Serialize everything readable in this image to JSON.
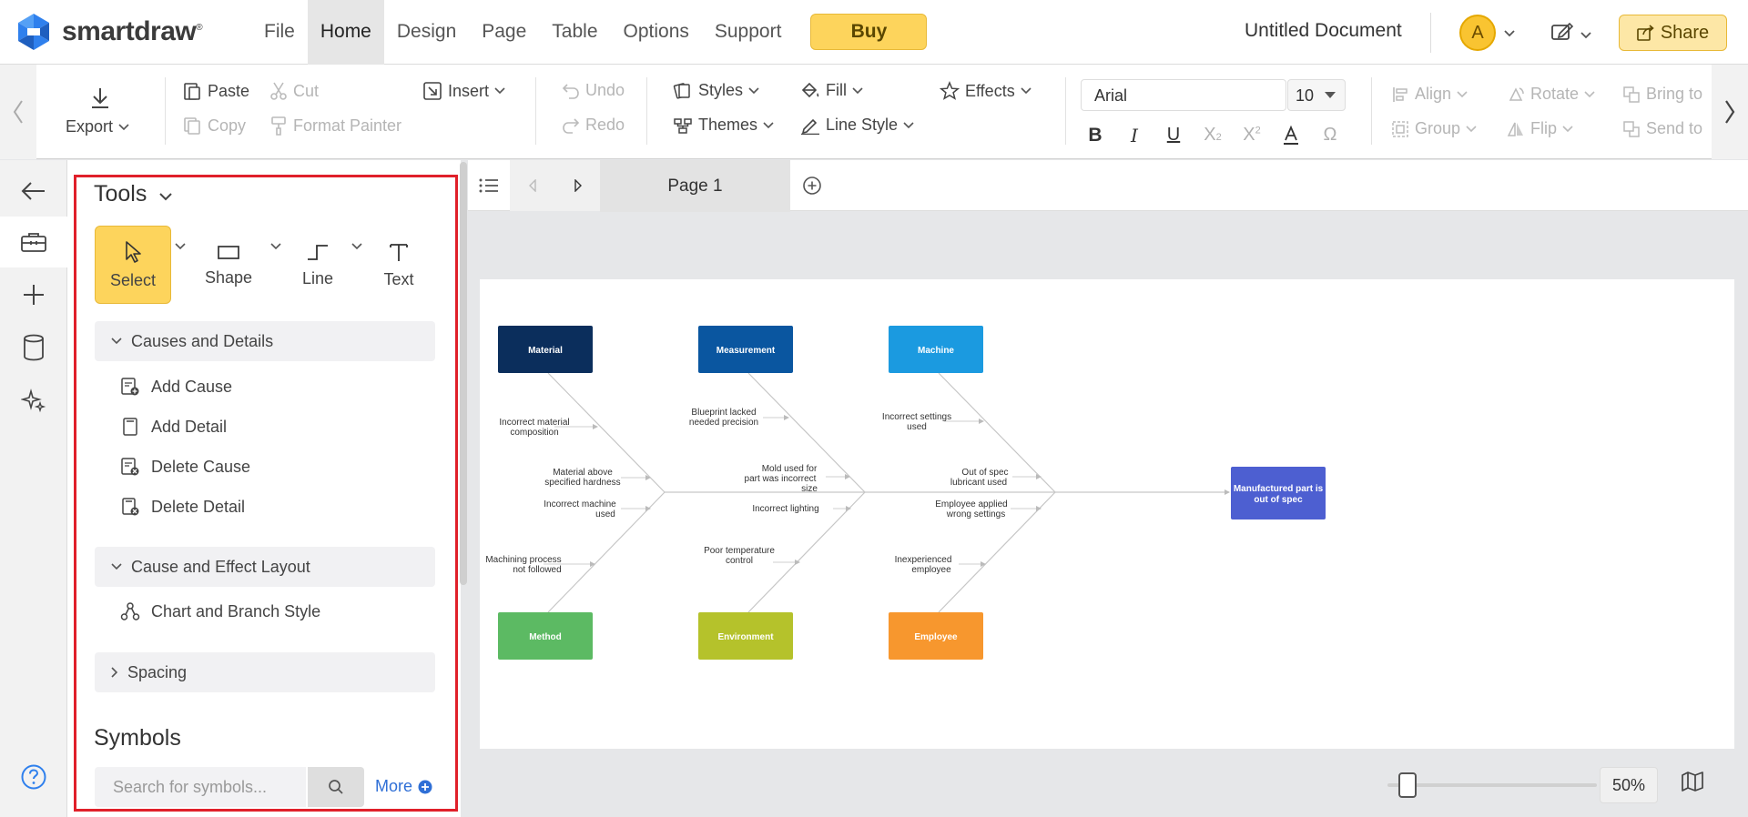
{
  "app": {
    "logo_text": "smartdraw",
    "logo_tm": "®",
    "menu": [
      "File",
      "Home",
      "Design",
      "Page",
      "Table",
      "Options",
      "Support"
    ],
    "active_menu": "Home",
    "buy_label": "Buy",
    "document_title": "Untitled Document",
    "avatar_initial": "A",
    "share_label": "Share",
    "colors": {
      "brand_blue": "#2c7be5",
      "accent_yellow": "#fdd45c",
      "highlight_red": "#e0202a"
    }
  },
  "ribbon": {
    "export": "Export",
    "paste": "Paste",
    "cut": "Cut",
    "copy": "Copy",
    "format_painter": "Format Painter",
    "insert": "Insert",
    "undo": "Undo",
    "redo": "Redo",
    "styles": "Styles",
    "themes": "Themes",
    "fill": "Fill",
    "line_style": "Line Style",
    "effects": "Effects",
    "font_name": "Arial",
    "font_size": "10",
    "align": "Align",
    "rotate": "Rotate",
    "bring_to": "Bring to",
    "group": "Group",
    "flip": "Flip",
    "send_to": "Send to"
  },
  "tools_panel": {
    "title": "Tools",
    "tools": {
      "select": "Select",
      "shape": "Shape",
      "line": "Line",
      "text": "Text"
    },
    "causes_section": "Causes and Details",
    "causes_items": [
      "Add Cause",
      "Add Detail",
      "Delete Cause",
      "Delete Detail"
    ],
    "layout_section": "Cause and Effect Layout",
    "layout_items": [
      "Chart and Branch Style"
    ],
    "spacing_section": "Spacing",
    "symbols_title": "Symbols",
    "search_placeholder": "Search for symbols...",
    "more_label": "More"
  },
  "canvas": {
    "page_tab": "Page 1",
    "zoom": "50%",
    "zoom_fraction": 0.08
  },
  "diagram": {
    "categories": {
      "material": "Material",
      "measurement": "Measurement",
      "machine": "Machine",
      "method": "Method",
      "environment": "Environment",
      "employee": "Employee"
    },
    "effect": [
      "Manufactured part is",
      "out of spec"
    ],
    "causes": {
      "c1": [
        "Incorrect material",
        "composition"
      ],
      "c2": [
        "Material above",
        "specified hardness"
      ],
      "c3": [
        "Blueprint lacked",
        "needed precision"
      ],
      "c4": [
        "Mold used for",
        "part was incorrect",
        "size"
      ],
      "c5": [
        "Incorrect settings",
        "used"
      ],
      "c6": [
        "Out of spec",
        "lubricant used"
      ],
      "c7": [
        "Incorrect machine",
        "used"
      ],
      "c8": [
        "Machining process",
        "not followed"
      ],
      "c9": [
        "Incorrect lighting"
      ],
      "c10": [
        "Poor temperature",
        "control"
      ],
      "c11": [
        "Employee applied",
        "wrong settings"
      ],
      "c12": [
        "Inexperienced",
        "employee"
      ]
    },
    "colors": {
      "material": "#0b2e5c",
      "measurement": "#0a56a0",
      "machine": "#1b9ae0",
      "method": "#5cba63",
      "environment": "#b5c22b",
      "employee": "#f7972e",
      "effect": "#4d5fd1"
    }
  }
}
